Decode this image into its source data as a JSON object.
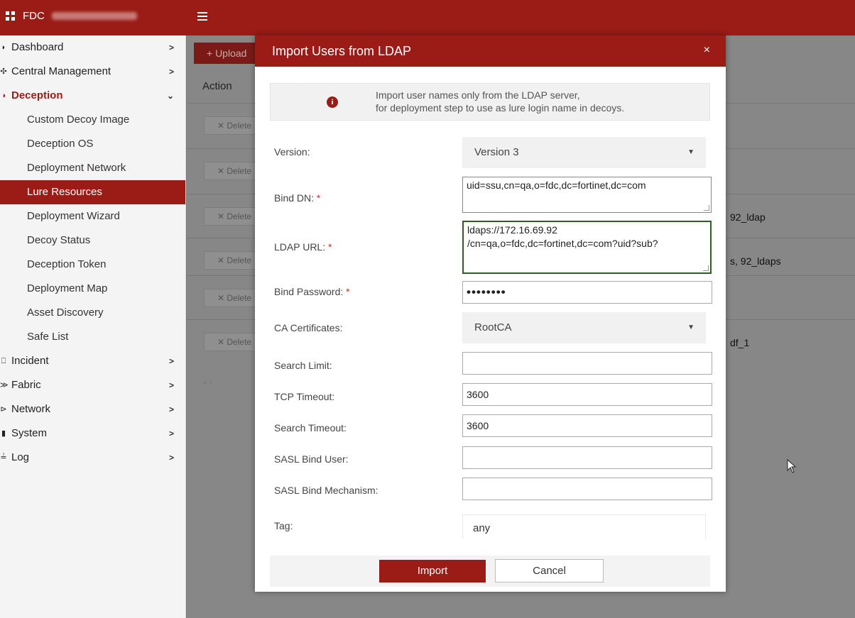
{
  "header": {
    "app_name": "FDC"
  },
  "sidebar": {
    "items": [
      {
        "label": "Dashboard",
        "icon": "dashboard-icon"
      },
      {
        "label": "Central Management",
        "icon": "central-management-icon"
      },
      {
        "label": "Deception",
        "icon": "deception-icon",
        "expanded": true
      },
      {
        "label": "Incident",
        "icon": "incident-icon"
      },
      {
        "label": "Fabric",
        "icon": "fabric-icon"
      },
      {
        "label": "Network",
        "icon": "network-icon"
      },
      {
        "label": "System",
        "icon": "system-icon"
      },
      {
        "label": "Log",
        "icon": "log-icon"
      }
    ],
    "deception_children": [
      "Custom Decoy Image",
      "Deception OS",
      "Deployment Network",
      "Lure Resources",
      "Deployment Wizard",
      "Decoy Status",
      "Deception Token",
      "Deployment Map",
      "Asset Discovery",
      "Safe List"
    ],
    "active_child": "Lure Resources"
  },
  "main": {
    "upload_label": "+ Upload",
    "action_header": "Action",
    "delete_label": "✕ Delete",
    "row_texts": [
      "",
      "",
      "92_ldap",
      "s, 92_ldaps",
      "",
      "df_1"
    ]
  },
  "modal": {
    "title": "Import Users from LDAP",
    "close_label": "×",
    "info_line1": "Import user names only from the LDAP server,",
    "info_line2": "for deployment step to use as lure login name in decoys.",
    "fields": {
      "version": {
        "label": "Version:",
        "value": "Version 3"
      },
      "bind_dn": {
        "label": "Bind DN:",
        "required": "*",
        "value": "uid=ssu,cn=qa,o=fdc,dc=fortinet,dc=com"
      },
      "ldap_url": {
        "label": "LDAP URL:",
        "required": "*",
        "line1": "ldaps://172.16.69.92",
        "line2": "/cn=qa,o=fdc,dc=fortinet,dc=com?uid?sub?"
      },
      "bind_password": {
        "label": "Bind Password:",
        "required": "*",
        "value": "••••••••"
      },
      "ca_certificates": {
        "label": "CA Certificates:",
        "value": "RootCA"
      },
      "search_limit": {
        "label": "Search Limit:",
        "value": ""
      },
      "tcp_timeout": {
        "label": "TCP Timeout:",
        "value": "3600"
      },
      "search_timeout": {
        "label": "Search Timeout:",
        "value": "3600"
      },
      "sasl_bind_user": {
        "label": "SASL Bind User:",
        "value": ""
      },
      "sasl_bind_mechanism": {
        "label": "SASL Bind Mechanism:",
        "value": ""
      },
      "tag": {
        "label": "Tag:",
        "value": "any"
      }
    },
    "import_label": "Import",
    "cancel_label": "Cancel"
  },
  "colors": {
    "brand_red": "#9b1b16",
    "required_red": "#c0392b",
    "focus_green": "#2e5e1f"
  }
}
